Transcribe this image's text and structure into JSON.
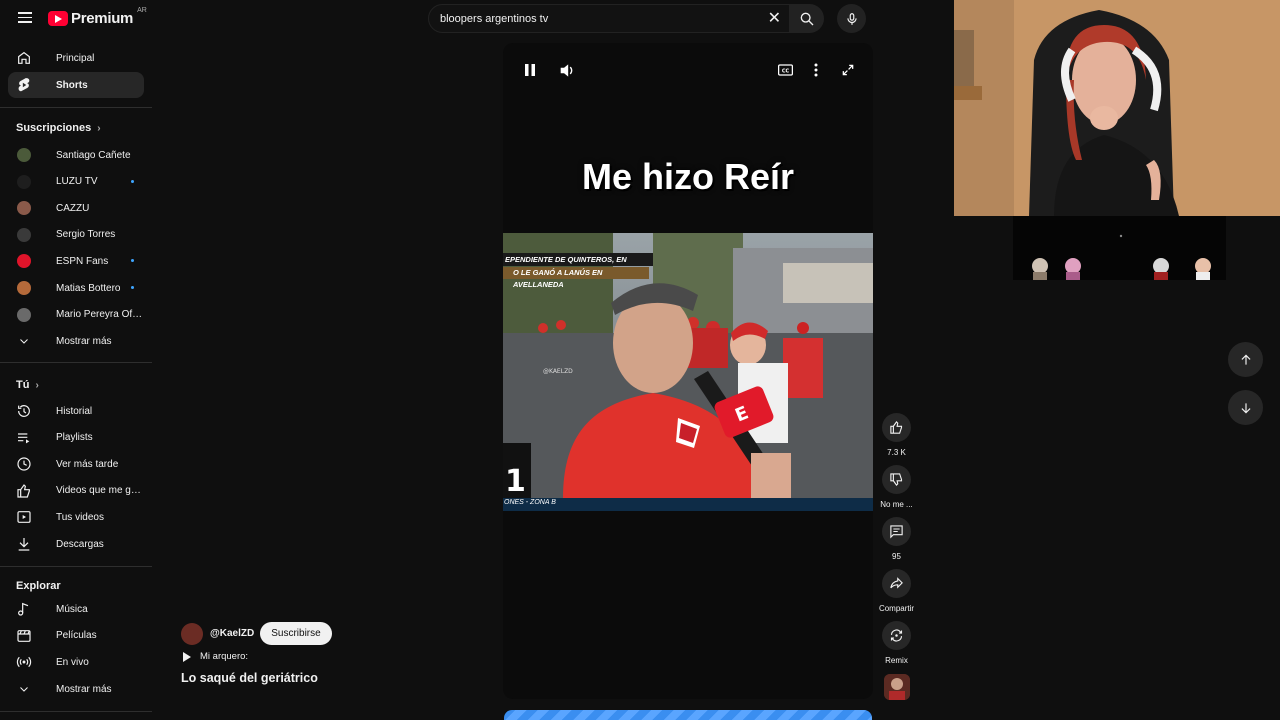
{
  "header": {
    "logo_text": "Premium",
    "region": "AR",
    "search_value": "bloopers argentinos tv",
    "icons": [
      "menu-icon",
      "search-icon",
      "mic-icon",
      "clear-icon"
    ]
  },
  "sidebar": {
    "main": [
      {
        "label": "Principal",
        "icon": "home-icon"
      },
      {
        "label": "Shorts",
        "icon": "shorts-icon",
        "active": true
      }
    ],
    "subs_title": "Suscripciones",
    "subscriptions": [
      {
        "label": "Santiago Cañete",
        "color": "#4b5a3a",
        "dot": false
      },
      {
        "label": "LUZU TV",
        "color": "#1e1e1e",
        "dot": true
      },
      {
        "label": "CAZZU",
        "color": "#8a5a4a",
        "dot": false
      },
      {
        "label": "Sergio Torres",
        "color": "#3a3a3a",
        "dot": false
      },
      {
        "label": "ESPN Fans",
        "color": "#e0142a",
        "dot": true
      },
      {
        "label": "Matias Bottero",
        "color": "#b56a3a",
        "dot": true
      },
      {
        "label": "Mario Pereyra Oficial",
        "color": "#6a6a6a",
        "dot": false
      }
    ],
    "subs_more": "Mostrar más",
    "you_title": "Tú",
    "you_items": [
      {
        "label": "Historial",
        "icon": "history-icon"
      },
      {
        "label": "Playlists",
        "icon": "playlists-icon"
      },
      {
        "label": "Ver más tarde",
        "icon": "clock-icon"
      },
      {
        "label": "Videos que me gus...",
        "icon": "thumb-up-icon"
      },
      {
        "label": "Tus videos",
        "icon": "your-videos-icon"
      },
      {
        "label": "Descargas",
        "icon": "download-icon"
      }
    ],
    "explore_title": "Explorar",
    "explore_items": [
      {
        "label": "Música",
        "icon": "music-icon"
      },
      {
        "label": "Películas",
        "icon": "film-icon"
      },
      {
        "label": "En vivo",
        "icon": "live-icon"
      }
    ],
    "explore_more": "Mostrar más"
  },
  "short": {
    "caption": "Me hizo Reír",
    "banner_line1": "EPENDIENTE DE QUINTEROS, EN RACHA",
    "banner_line2": "O LE GANÓ A LANÚS EN AVELLANEDA",
    "ticker": "ONES - ZONA B",
    "watermark": "@KAELZD",
    "channel": "@KaelZD",
    "subscribe": "Suscribirse",
    "sound": "Mi arquero:",
    "title": "Lo saqué del geriátrico"
  },
  "actions": {
    "likes": "7.3 K",
    "dislike": "No me ...",
    "comments": "95",
    "share": "Compartir",
    "remix": "Remix"
  },
  "colors": {
    "background": "#0f0f0f",
    "accent": "#ff0033",
    "new_dot": "#3ea6ff",
    "surface": "#272727"
  }
}
